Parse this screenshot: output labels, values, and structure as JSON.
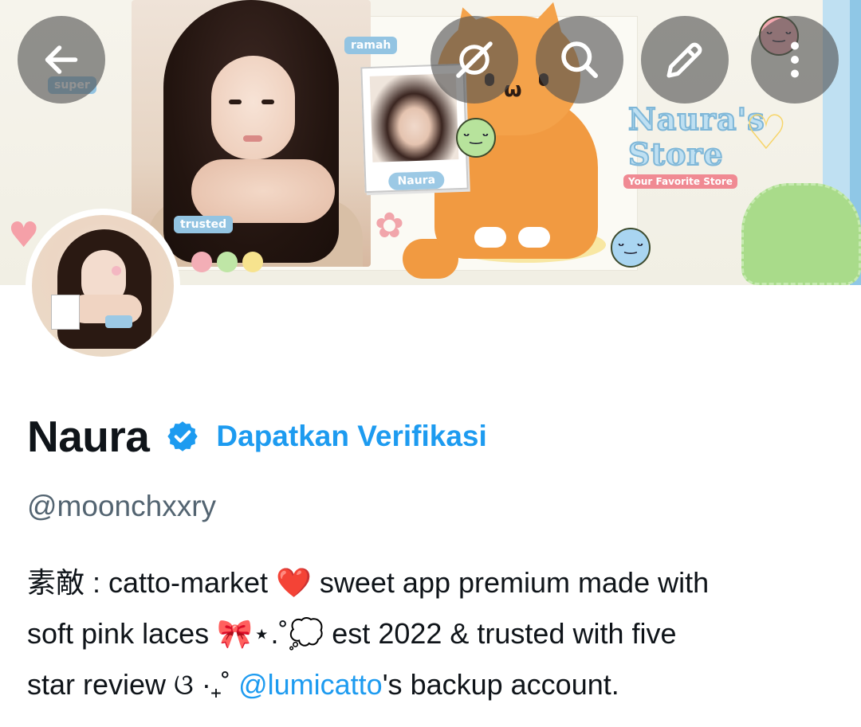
{
  "header": {
    "banner_texts": {
      "store_title": "Naura's Store",
      "store_subtitle": "Your Favorite Store",
      "tag_ramah": "ramah",
      "tag_super": "super",
      "tag_trusted": "trusted",
      "polaroid_label": "Naura"
    },
    "buttons": [
      {
        "name": "back",
        "icon": "arrow-left-icon"
      },
      {
        "name": "grok",
        "icon": "grok-icon"
      },
      {
        "name": "search",
        "icon": "search-icon"
      },
      {
        "name": "edit",
        "icon": "pencil-icon"
      },
      {
        "name": "more",
        "icon": "more-vertical-icon"
      }
    ]
  },
  "profile": {
    "display_name": "Naura",
    "verify_cta": "Dapatkan Verifikasi",
    "handle": "@moonchxxry",
    "bio": {
      "line1": "素敵 : catto-market ❤️ sweet app premium made with",
      "line2": "soft pink laces 🎀⋆.˚💭 est 2022 & trusted with five",
      "line3_before": "star review ଓ ·₊˚ ",
      "mention": "@lumicatto",
      "line3_after": "'s backup account."
    }
  },
  "colors": {
    "accent": "#1d9bf0",
    "text_primary": "#0f1419",
    "text_secondary": "#536471",
    "overlay_button": "#505050"
  }
}
